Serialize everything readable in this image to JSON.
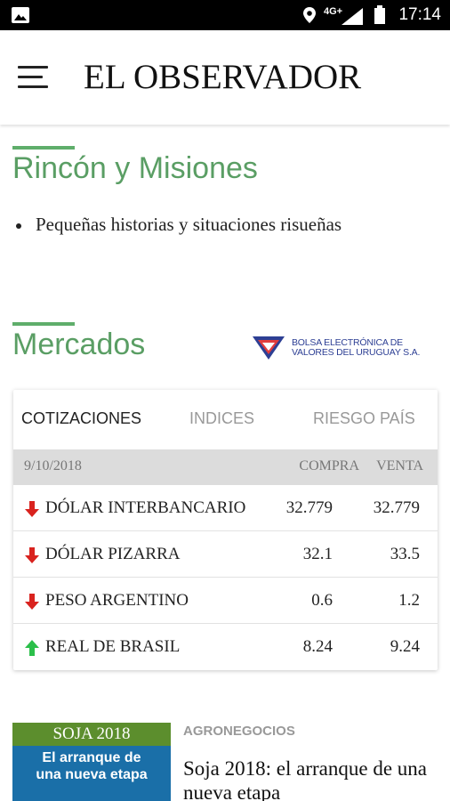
{
  "status_bar": {
    "time": "17:14",
    "network": "4G+",
    "icons": [
      "gallery-icon",
      "location-icon",
      "signal-icon",
      "battery-icon"
    ]
  },
  "header": {
    "menu_icon": "hamburger-menu-icon",
    "logo_text": "EL OBSERVADOR"
  },
  "section_rincon": {
    "title": "Rincón y Misiones",
    "items": [
      "Pequeñas historias y situaciones risueñas"
    ]
  },
  "section_mercados": {
    "title": "Mercados",
    "partner_logo_line1": "BOLSA ELECTRÓNICA DE",
    "partner_logo_line2": "VALORES DEL URUGUAY S.A."
  },
  "market_card": {
    "tabs": [
      {
        "label": "COTIZACIONES",
        "active": true
      },
      {
        "label": "INDICES",
        "active": false
      },
      {
        "label": "RIESGO PAÍS",
        "active": false
      }
    ],
    "header": {
      "date": "9/10/2018",
      "buy": "COMPRA",
      "sell": "VENTA"
    },
    "rows": [
      {
        "name": "DÓLAR INTERBANCARIO",
        "buy": "32.779",
        "sell": "32.779",
        "trend": "down"
      },
      {
        "name": "DÓLAR PIZARRA",
        "buy": "32.1",
        "sell": "33.5",
        "trend": "down"
      },
      {
        "name": "PESO ARGENTINO",
        "buy": "0.6",
        "sell": "1.2",
        "trend": "down"
      },
      {
        "name": "REAL DE BRASIL",
        "buy": "8.24",
        "sell": "9.24",
        "trend": "up"
      }
    ],
    "colors": {
      "down": "#d9231f",
      "up": "#2bbf4a"
    }
  },
  "news": {
    "kicker": "AGRONEGOCIOS",
    "headline": "Soja 2018: el arranque de una nueva etapa",
    "thumb_title": "SOJA 2018",
    "thumb_sub_line1": "El arranque de",
    "thumb_sub_line2": "una nueva etapa"
  },
  "colors": {
    "accent_green": "#5a9e64",
    "brand_text": "#111111"
  }
}
